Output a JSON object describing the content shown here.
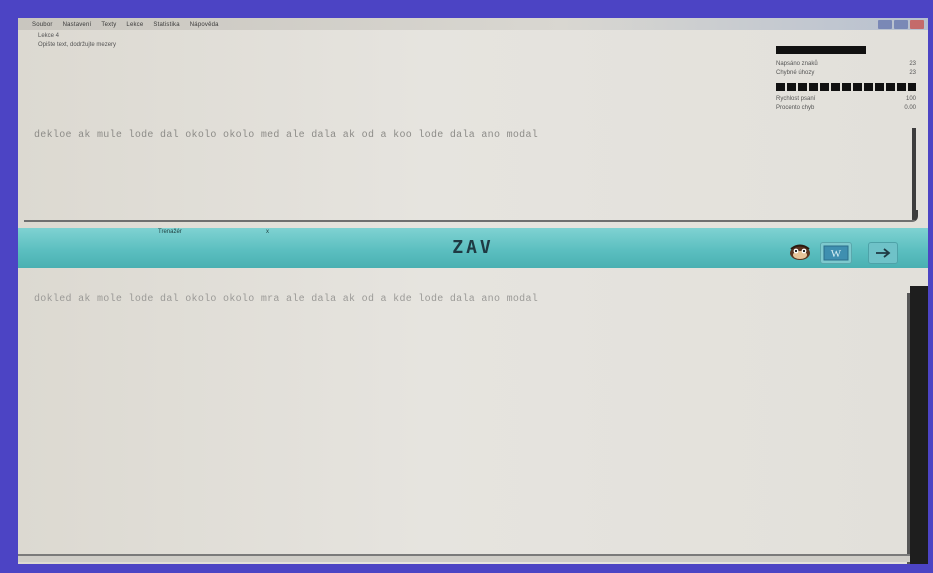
{
  "menu": {
    "items": [
      "Soubor",
      "Nastavení",
      "Texty",
      "Lekce",
      "Statistika",
      "Nápověda"
    ]
  },
  "header": {
    "line1": "Lekce 4",
    "line2": "Opište text, dodržujte mezery"
  },
  "stats": {
    "row1_label": "Napsáno znaků",
    "row1_value": "23",
    "row2_label": "Chybné úhozy",
    "row2_value": "23",
    "row3_label": "Rychlost psaní",
    "row3_value": "100",
    "row4_label": "Procento chyb",
    "row4_value": "0.00"
  },
  "source": {
    "text": "dekloe ak mule lode dal okolo okolo med ale dala ak od a koo lode dala ano modal"
  },
  "toolbar": {
    "label": "Trenažér",
    "marker": "x",
    "title": "ZAV",
    "w_label": "W"
  },
  "target": {
    "text": "dokled ak mole lode dal okolo okolo mra ale dala ak od a kde lode dala ano modal"
  },
  "colors": {
    "desktop": "#4c44c4",
    "toolbar": "#5cbfc0",
    "paper": "#e4e2dc"
  }
}
